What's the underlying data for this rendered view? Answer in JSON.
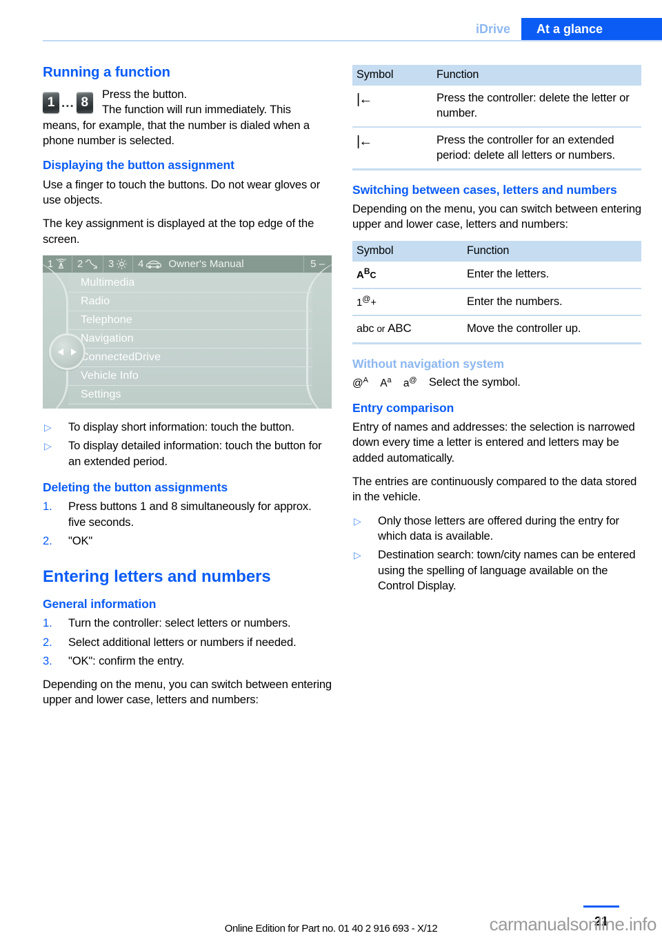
{
  "header": {
    "tab_idrive": "iDrive",
    "tab_glance": "At a glance",
    "accent_blue": "#0a5cf5",
    "light_blue": "#8db8f0",
    "rule_blue": "#bed8f3"
  },
  "left": {
    "running": {
      "heading": "Running a function",
      "key_from": "1",
      "key_dots": "...",
      "key_to": "8",
      "line1": "Press the button.",
      "line2": "The function will run immediately. This",
      "body": "means, for example, that the number is dialed when a phone number is selected."
    },
    "displaying": {
      "heading": "Displaying the button assignment",
      "p1": "Use a finger to touch the buttons. Do not wear gloves or use objects.",
      "p2": "The key assignment is displayed at the top edge of the screen."
    },
    "screen": {
      "statusbar": [
        {
          "num": "1",
          "icon": "antenna-icon"
        },
        {
          "num": "2",
          "icon": "phone-handset-icon"
        },
        {
          "num": "3",
          "icon": "gear-icon"
        },
        {
          "num": "4",
          "icon": "car-icon"
        }
      ],
      "title": "Owner's Manual",
      "right_label": "5 –",
      "menu": [
        "Multimedia",
        "Radio",
        "Telephone",
        "Navigation",
        "ConnectedDrive",
        "Vehicle Info",
        "Settings"
      ]
    },
    "bullets": [
      "To display short information: touch the button.",
      "To display detailed information: touch the button for an extended period."
    ],
    "deleting": {
      "heading": "Deleting the button assignments",
      "steps": [
        {
          "num": "1.",
          "text": "Press buttons 1 and 8 simultaneously for approx. five seconds."
        },
        {
          "num": "2.",
          "text": "\"OK\""
        }
      ]
    },
    "entering": {
      "heading": "Entering letters and numbers",
      "sub": "General information",
      "steps": [
        {
          "num": "1.",
          "text": "Turn the controller: select letters or numbers."
        },
        {
          "num": "2.",
          "text": "Select additional letters or numbers if needed."
        },
        {
          "num": "3.",
          "text": "\"OK\": confirm the entry."
        }
      ],
      "closing": "Depending on the menu, you can switch between entering upper and lower case, letters and numbers:"
    }
  },
  "right": {
    "table1": {
      "headers": [
        "Symbol",
        "Function"
      ],
      "rows": [
        {
          "symbol": "|←",
          "symbol_name": "backspace-icon",
          "function": "Press the controller: delete the letter or number."
        },
        {
          "symbol": "|←",
          "symbol_name": "backspace-icon",
          "function": "Press the controller for an extended period: delete all letters or numbers."
        }
      ]
    },
    "switching": {
      "heading": "Switching between cases, letters and numbers",
      "intro": "Depending on the menu, you can switch between entering upper and lower case, letters and numbers:"
    },
    "table2": {
      "headers": [
        "Symbol",
        "Function"
      ],
      "rows": [
        {
          "sym_a": "A",
          "sym_sup": "B",
          "sym_c": "C",
          "kind": "abc",
          "function": "Enter the letters."
        },
        {
          "sym_a": "1",
          "sym_sup": "@",
          "sym_c": "+",
          "kind": "num",
          "function": "Enter the numbers."
        },
        {
          "sym_a": "abc",
          "sym_or": "or",
          "sym_c": "ABC",
          "kind": "case",
          "function": "Move the controller up."
        }
      ]
    },
    "without_nav": {
      "heading": "Without navigation system",
      "sym1_base": "@",
      "sym1_sup": "A",
      "sym2_base": "A",
      "sym2_sup": "a",
      "sym3_base": "a",
      "sym3_sup": "@",
      "text": "Select the symbol."
    },
    "entry_comparison": {
      "heading": "Entry comparison",
      "p1": "Entry of names and addresses: the selection is narrowed down every time a letter is entered and letters may be added automatically.",
      "p2": "The entries are continuously compared to the data stored in the vehicle.",
      "bullets": [
        "Only those letters are offered during the entry for which data is available.",
        "Destination search: town/city names can be entered using the spelling of language available on the Control Display."
      ]
    }
  },
  "footer": {
    "edition": "Online Edition for Part no. 01 40 2 916 693 - X/12",
    "page_number": "21",
    "watermark": "carmanualsonline.info"
  }
}
